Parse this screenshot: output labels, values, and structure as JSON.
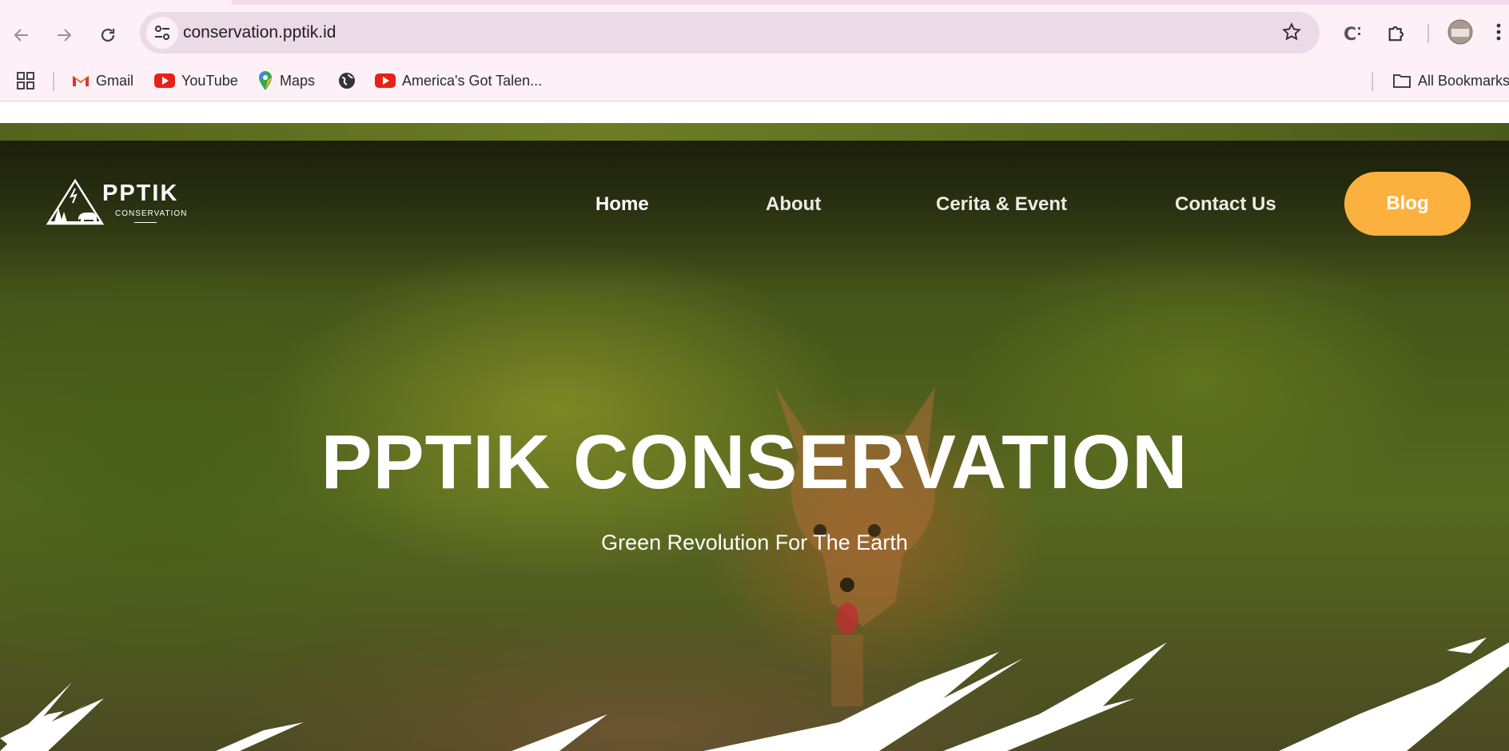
{
  "browser": {
    "url": "conservation.pptik.id",
    "bookmarks": [
      {
        "label": "Gmail",
        "icon": "gmail-icon"
      },
      {
        "label": "YouTube",
        "icon": "youtube-icon"
      },
      {
        "label": "Maps",
        "icon": "maps-icon"
      },
      {
        "label": "",
        "icon": "globe-icon"
      },
      {
        "label": "America's Got Talen...",
        "icon": "youtube-icon"
      }
    ],
    "all_bookmarks": "All Bookmarks"
  },
  "site": {
    "logo_title": "PPTIK",
    "logo_subtitle": "CONSERVATION",
    "nav": [
      "Home",
      "About",
      "Cerita & Event",
      "Contact Us"
    ],
    "cta": "Blog",
    "hero_title": "PPTIK CONSERVATION",
    "hero_subtitle": "Green Revolution For The Earth"
  },
  "colors": {
    "accent": "#fcb13f",
    "chrome_bg": "#fdf0f6",
    "omnibox_bg": "#ecdbe7"
  }
}
